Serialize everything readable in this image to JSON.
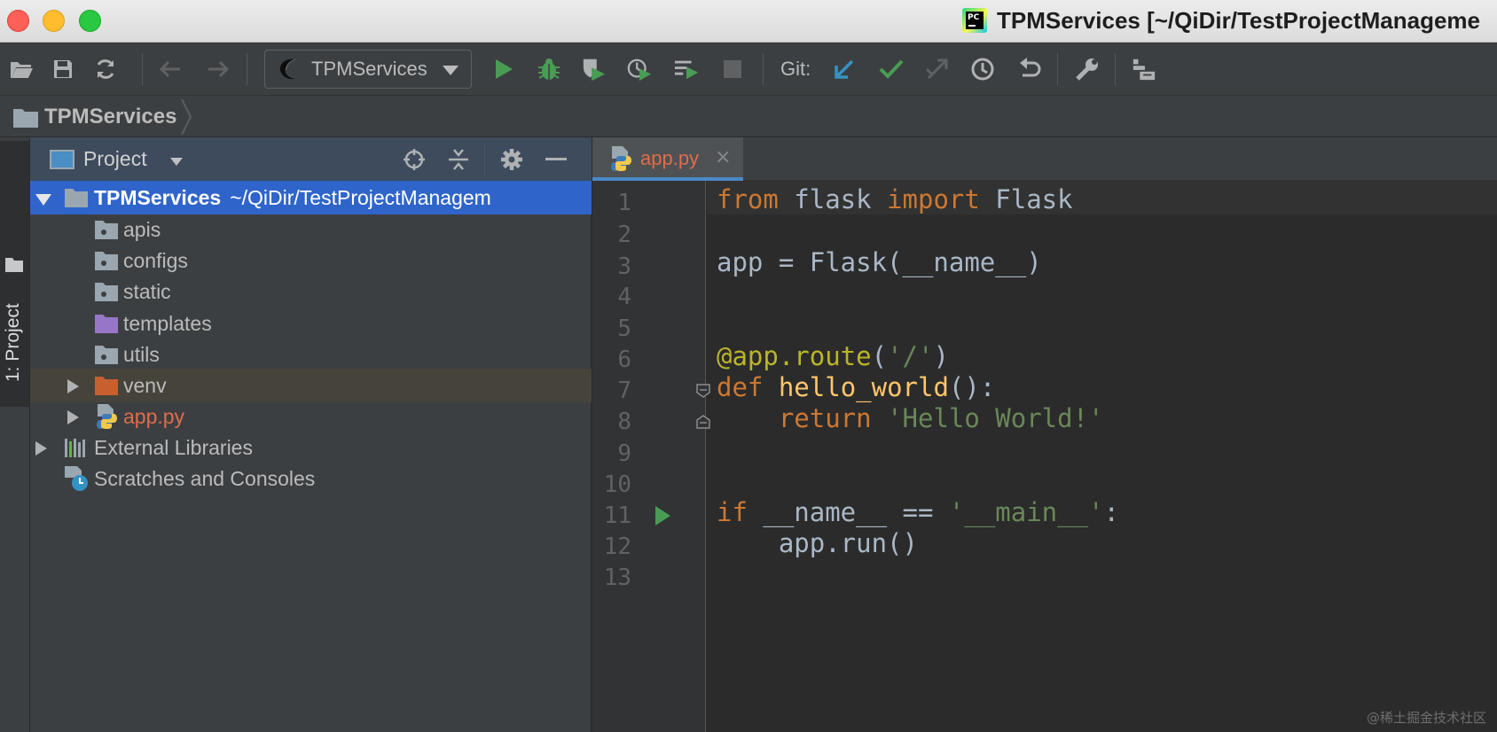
{
  "window": {
    "title": "TPMServices [~/QiDir/TestProjectManageme"
  },
  "toolbar": {
    "run_config_label": "TPMServices",
    "git_label": "Git:",
    "icons": [
      "open-folder-icon",
      "save-icon",
      "sync-icon",
      "back-arrow-icon",
      "forward-arrow-icon",
      "run-icon",
      "debug-icon",
      "coverage-icon",
      "profile-icon",
      "concurrency-icon",
      "stop-icon",
      "git-update-icon",
      "git-commit-icon",
      "git-push-icon",
      "history-icon",
      "revert-icon",
      "wrench-icon",
      "structure-icon"
    ]
  },
  "breadcrumb": {
    "label": "TPMServices"
  },
  "tool_strip": {
    "project_tab_label": "1: Project"
  },
  "project_panel": {
    "title": "Project",
    "tree": [
      {
        "name": "TPMServices",
        "path": "~/QiDir/TestProjectManagem",
        "type": "root"
      },
      {
        "name": "apis",
        "type": "folder"
      },
      {
        "name": "configs",
        "type": "folder"
      },
      {
        "name": "static",
        "type": "folder"
      },
      {
        "name": "templates",
        "type": "folder-purple"
      },
      {
        "name": "utils",
        "type": "folder"
      },
      {
        "name": "venv",
        "type": "folder-orange"
      },
      {
        "name": "app.py",
        "type": "python-file"
      },
      {
        "name": "External Libraries",
        "type": "libraries"
      },
      {
        "name": "Scratches and Consoles",
        "type": "scratches"
      }
    ]
  },
  "editor": {
    "active_tab": "app.py",
    "close_glyph": "×",
    "line_numbers": [
      "1",
      "2",
      "3",
      "4",
      "5",
      "6",
      "7",
      "8",
      "9",
      "10",
      "11",
      "12",
      "13"
    ],
    "code": {
      "l1_from": "from",
      "l1_mod": " flask ",
      "l1_import": "import",
      "l1_cls": " Flask",
      "l3": "app = Flask(__name__)",
      "l6_dec": "@app.route",
      "l6_open": "(",
      "l6_str": "'/'",
      "l6_close": ")",
      "l7_def": "def",
      "l7_fn": " hello_world",
      "l7_rest": "():",
      "l8_indent": "    ",
      "l8_return": "return",
      "l8_str": " 'Hello World!'",
      "l11_if": "if",
      "l11_mid": " __name__ == ",
      "l11_str": "'__main__'",
      "l11_colon": ":",
      "l12": "    app.run()"
    }
  },
  "watermark": "@稀土掘金技术社区",
  "colors": {
    "keyword": "#cc7832",
    "decorator": "#bbb529",
    "function": "#ffc66d",
    "string": "#6a8759",
    "plain": "#a9b7c6",
    "selection": "#2f65ca"
  }
}
